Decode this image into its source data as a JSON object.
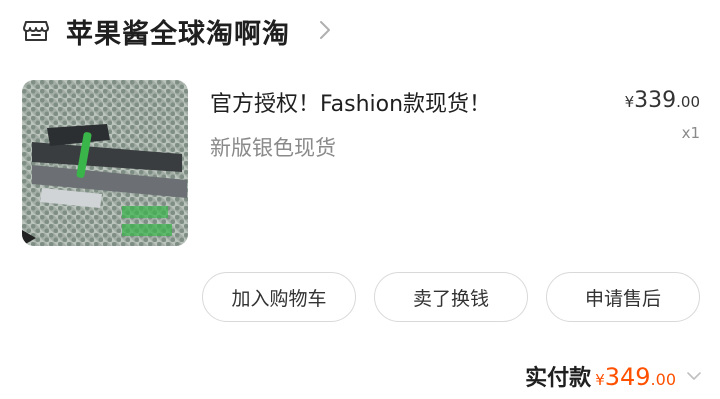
{
  "shop": {
    "name": "苹果酱全球淘啊淘",
    "icon": "store-icon"
  },
  "item": {
    "title": "官方授权！Fashion款现货！",
    "sku": "新版银色现货",
    "price": {
      "currency": "¥",
      "integer": "339",
      "decimal": ".00"
    },
    "quantity": "x1"
  },
  "actions": {
    "add_to_cart": "加入购物车",
    "resell": "卖了换钱",
    "after_sales": "申请售后"
  },
  "payment": {
    "label": "实付款",
    "currency": "¥",
    "integer": "349",
    "decimal": ".00"
  },
  "colors": {
    "accent": "#ff5000",
    "text": "#1f1f1f",
    "muted": "#8a8a8a",
    "border": "#d9d9d9"
  }
}
